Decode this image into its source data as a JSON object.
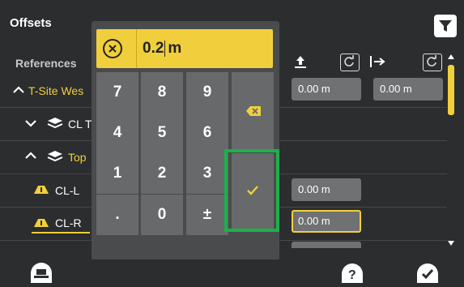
{
  "header": {
    "title": "Offsets"
  },
  "references": {
    "label": "References",
    "value_a": "0.00 m",
    "value_b": "0.00 m",
    "rows": [
      {
        "label": "T-Site Wes",
        "expanded": true
      },
      {
        "label": "CL T",
        "expanded": false
      },
      {
        "label": "Top",
        "expanded": true
      },
      {
        "label": "CL-L",
        "value": "0.00 m"
      },
      {
        "label": "CL-R",
        "value": "0.00 m"
      },
      {
        "label": "",
        "value": ""
      }
    ]
  },
  "keypad": {
    "display_value": "0.2",
    "display_unit": "m",
    "keys": [
      "7",
      "8",
      "9",
      "4",
      "5",
      "6",
      "1",
      "2",
      "3",
      ".",
      "0",
      "±"
    ]
  },
  "colors": {
    "accent": "#f1cf3c",
    "highlight": "#1db04a",
    "panel": "#494b4d",
    "key": "#67696b"
  },
  "icons": [
    "filter-icon",
    "clear-icon",
    "backspace-icon",
    "check-icon",
    "elevation-icon",
    "rotate-icon",
    "horizontal-offset-icon",
    "layers-icon",
    "road-icon",
    "machine-icon",
    "help-icon",
    "confirm-icon",
    "scroll-up-icon",
    "scroll-down-icon"
  ]
}
